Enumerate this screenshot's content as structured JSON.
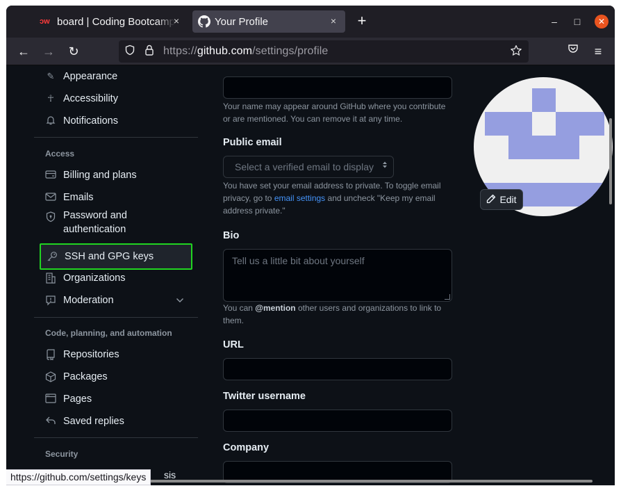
{
  "browser": {
    "tabs": [
      {
        "label": "board | Coding Bootcamp",
        "close": "×",
        "favicon": "ↄw"
      },
      {
        "label": "Your Profile",
        "close": "×"
      }
    ],
    "new_tab": "+",
    "window_controls": {
      "minimize": "–",
      "maximize": "□",
      "close": "✕"
    },
    "nav": {
      "back": "←",
      "forward": "→",
      "reload": "↻",
      "menu": "≡"
    },
    "url": {
      "prefix": "https://",
      "host": "github.com",
      "path": "/settings/profile"
    },
    "status_url": "https://github.com/settings/keys"
  },
  "sidebar": {
    "top_items": [
      {
        "label": "Appearance",
        "icon": "paintbrush-icon",
        "glyph": "✎"
      },
      {
        "label": "Accessibility",
        "icon": "accessibility-icon",
        "glyph": "☥"
      },
      {
        "label": "Notifications",
        "icon": "bell-icon",
        "glyph": "🔔"
      }
    ],
    "access_heading": "Access",
    "access_items": [
      {
        "label": "Billing and plans",
        "icon": "credit-card-icon",
        "glyph": "▭"
      },
      {
        "label": "Emails",
        "icon": "mail-icon",
        "glyph": "✉"
      },
      {
        "label": "Password and authentication",
        "icon": "shield-lock-icon",
        "glyph": "⛉"
      },
      {
        "label": "SSH and GPG keys",
        "icon": "key-icon",
        "glyph": "⚿"
      },
      {
        "label": "Organizations",
        "icon": "organization-icon",
        "glyph": "▦"
      },
      {
        "label": "Moderation",
        "icon": "report-icon",
        "glyph": "⚐",
        "chevron": "⌄"
      }
    ],
    "code_heading": "Code, planning, and automation",
    "code_items": [
      {
        "label": "Repositories",
        "icon": "repo-icon",
        "glyph": "▤"
      },
      {
        "label": "Packages",
        "icon": "package-icon",
        "glyph": "⬡"
      },
      {
        "label": "Pages",
        "icon": "browser-icon",
        "glyph": "▭"
      },
      {
        "label": "Saved replies",
        "icon": "reply-icon",
        "glyph": "↰"
      }
    ],
    "security_heading": "Security",
    "cut_off_text": "sis"
  },
  "form": {
    "name_note": "Your name may appear around GitHub where you contribute or are mentioned. You can remove it at any time.",
    "public_email_label": "Public email",
    "public_email_select": "Select a verified email to display",
    "email_note_before": "You have set your email address to private. To toggle email privacy, go to ",
    "email_note_link": "email settings",
    "email_note_after": " and uncheck \"Keep my email address private.\"",
    "bio_label": "Bio",
    "bio_placeholder": "Tell us a little bit about yourself",
    "bio_note_before": "You can ",
    "bio_note_mention": "@mention",
    "bio_note_after": " other users and organizations to link to them.",
    "url_label": "URL",
    "twitter_label": "Twitter username",
    "company_label": "Company"
  },
  "avatar": {
    "edit_label": "Edit",
    "edit_icon": "pencil-icon",
    "color": "#959ee0"
  },
  "colors": {
    "selected_outline": "#21d521",
    "link": "#4493f8",
    "page_bg": "#0d1117"
  }
}
